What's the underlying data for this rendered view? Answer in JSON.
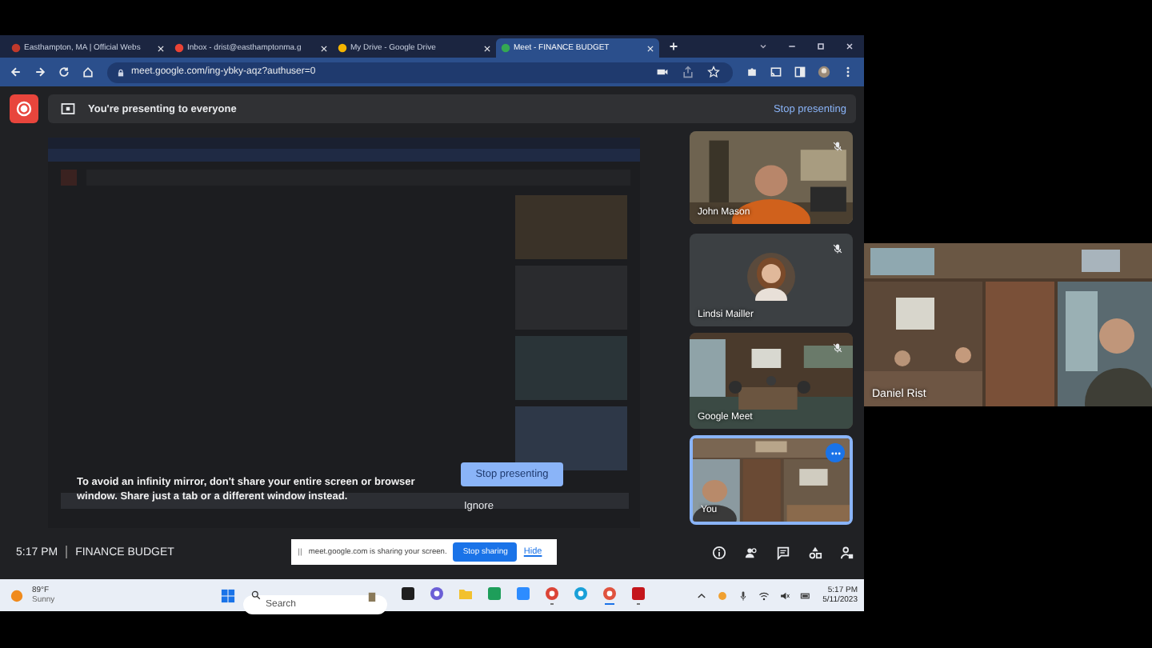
{
  "browser": {
    "tabs": [
      {
        "title": "Easthampton, MA | Official Webs",
        "selected": false
      },
      {
        "title": "Inbox - drist@easthamptonma.g",
        "selected": false
      },
      {
        "title": "My Drive - Google Drive",
        "selected": false
      },
      {
        "title": "Meet - FINANCE BUDGET",
        "selected": true
      }
    ],
    "url": "meet.google.com/ing-ybky-aqz?authuser=0"
  },
  "meet": {
    "banner": {
      "text": "You're presenting to everyone",
      "action": "Stop presenting"
    },
    "warning": {
      "text": "To avoid an infinity mirror, don't share your entire screen or browser window. Share just a tab or a different window instead.",
      "button": "Stop presenting",
      "dismiss": "Ignore"
    },
    "tiles": [
      {
        "name": "John Mason",
        "kind": "video",
        "muted": true,
        "selected": false
      },
      {
        "name": "Lindsi Mailler",
        "kind": "avatar",
        "muted": true,
        "selected": false
      },
      {
        "name": "Google Meet",
        "kind": "video",
        "muted": true,
        "selected": false
      },
      {
        "name": "You",
        "kind": "video",
        "muted": false,
        "selected": true
      }
    ],
    "time": "5:17 PM",
    "meeting": "FINANCE BUDGET",
    "share_notice": {
      "text": "meet.google.com is sharing your screen.",
      "button": "Stop sharing",
      "link": "Hide"
    }
  },
  "taskbar": {
    "weather": {
      "temp": "89°F",
      "condition": "Sunny"
    },
    "search": {
      "placeholder": "Search"
    },
    "apps": [
      {
        "running": false,
        "active": false
      },
      {
        "running": false,
        "active": false
      },
      {
        "running": false,
        "active": false
      },
      {
        "running": false,
        "active": false
      },
      {
        "running": false,
        "active": false
      },
      {
        "running": true,
        "active": false
      },
      {
        "running": false,
        "active": false
      },
      {
        "running": true,
        "active": true
      },
      {
        "running": true,
        "active": false
      }
    ],
    "time": "5:17 PM",
    "date": "5/11/2023"
  },
  "side_tile": {
    "name": "Daniel Rist"
  }
}
